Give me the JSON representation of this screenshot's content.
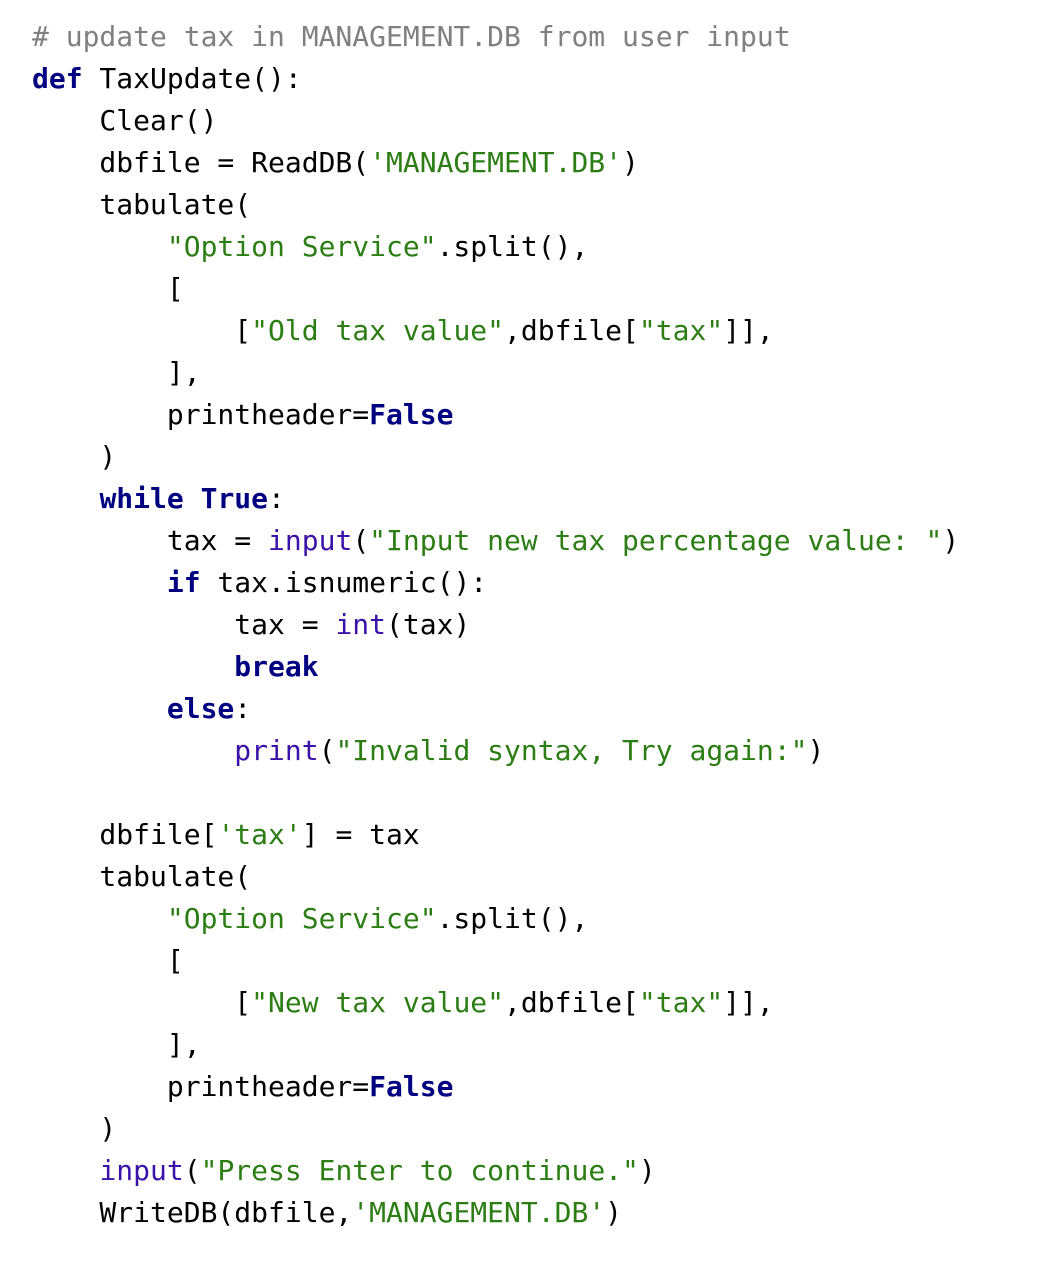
{
  "editor": {
    "colors": {
      "background": "#ffffff",
      "comment": "#808080",
      "keyword": "#000080",
      "string": "#2b7d14",
      "builtin": "#3b12a8",
      "plain": "#000000"
    },
    "lines": [
      [
        {
          "t": "comment",
          "v": "# update tax in MANAGEMENT.DB from user input"
        }
      ],
      [
        {
          "t": "keyword",
          "v": "def"
        },
        {
          "t": "plain",
          "v": " TaxUpdate():"
        }
      ],
      [
        {
          "t": "plain",
          "v": "    Clear()"
        }
      ],
      [
        {
          "t": "plain",
          "v": "    dbfile = ReadDB("
        },
        {
          "t": "string",
          "v": "'MANAGEMENT.DB'"
        },
        {
          "t": "plain",
          "v": ")"
        }
      ],
      [
        {
          "t": "plain",
          "v": "    tabulate("
        }
      ],
      [
        {
          "t": "plain",
          "v": "        "
        },
        {
          "t": "string",
          "v": "\"Option Service\""
        },
        {
          "t": "plain",
          "v": ".split(),"
        }
      ],
      [
        {
          "t": "plain",
          "v": "        ["
        }
      ],
      [
        {
          "t": "plain",
          "v": "            ["
        },
        {
          "t": "string",
          "v": "\"Old tax value\""
        },
        {
          "t": "plain",
          "v": ",dbfile["
        },
        {
          "t": "string",
          "v": "\"tax\""
        },
        {
          "t": "plain",
          "v": "]],"
        }
      ],
      [
        {
          "t": "plain",
          "v": "        ],"
        }
      ],
      [
        {
          "t": "plain",
          "v": "        printheader="
        },
        {
          "t": "keyword",
          "v": "False"
        }
      ],
      [
        {
          "t": "plain",
          "v": "    )"
        }
      ],
      [
        {
          "t": "plain",
          "v": "    "
        },
        {
          "t": "keyword",
          "v": "while"
        },
        {
          "t": "plain",
          "v": " "
        },
        {
          "t": "keyword",
          "v": "True"
        },
        {
          "t": "plain",
          "v": ":"
        }
      ],
      [
        {
          "t": "plain",
          "v": "        tax = "
        },
        {
          "t": "builtin",
          "v": "input"
        },
        {
          "t": "plain",
          "v": "("
        },
        {
          "t": "string",
          "v": "\"Input new tax percentage value: \""
        },
        {
          "t": "plain",
          "v": ")"
        }
      ],
      [
        {
          "t": "plain",
          "v": "        "
        },
        {
          "t": "keyword",
          "v": "if"
        },
        {
          "t": "plain",
          "v": " tax.isnumeric():"
        }
      ],
      [
        {
          "t": "plain",
          "v": "            tax = "
        },
        {
          "t": "builtin",
          "v": "int"
        },
        {
          "t": "plain",
          "v": "(tax)"
        }
      ],
      [
        {
          "t": "plain",
          "v": "            "
        },
        {
          "t": "keyword",
          "v": "break"
        }
      ],
      [
        {
          "t": "plain",
          "v": "        "
        },
        {
          "t": "keyword",
          "v": "else"
        },
        {
          "t": "plain",
          "v": ":"
        }
      ],
      [
        {
          "t": "plain",
          "v": "            "
        },
        {
          "t": "builtin",
          "v": "print"
        },
        {
          "t": "plain",
          "v": "("
        },
        {
          "t": "string",
          "v": "\"Invalid syntax, Try again:\""
        },
        {
          "t": "plain",
          "v": ")"
        }
      ],
      [],
      [
        {
          "t": "plain",
          "v": "    dbfile["
        },
        {
          "t": "string",
          "v": "'tax'"
        },
        {
          "t": "plain",
          "v": "] = tax"
        }
      ],
      [
        {
          "t": "plain",
          "v": "    tabulate("
        }
      ],
      [
        {
          "t": "plain",
          "v": "        "
        },
        {
          "t": "string",
          "v": "\"Option Service\""
        },
        {
          "t": "plain",
          "v": ".split(),"
        }
      ],
      [
        {
          "t": "plain",
          "v": "        ["
        }
      ],
      [
        {
          "t": "plain",
          "v": "            ["
        },
        {
          "t": "string",
          "v": "\"New tax value\""
        },
        {
          "t": "plain",
          "v": ",dbfile["
        },
        {
          "t": "string",
          "v": "\"tax\""
        },
        {
          "t": "plain",
          "v": "]],"
        }
      ],
      [
        {
          "t": "plain",
          "v": "        ],"
        }
      ],
      [
        {
          "t": "plain",
          "v": "        printheader="
        },
        {
          "t": "keyword",
          "v": "False"
        }
      ],
      [
        {
          "t": "plain",
          "v": "    )"
        }
      ],
      [
        {
          "t": "plain",
          "v": "    "
        },
        {
          "t": "builtin",
          "v": "input"
        },
        {
          "t": "plain",
          "v": "("
        },
        {
          "t": "string",
          "v": "\"Press Enter to continue.\""
        },
        {
          "t": "plain",
          "v": ")"
        }
      ],
      [
        {
          "t": "plain",
          "v": "    WriteDB(dbfile,"
        },
        {
          "t": "string",
          "v": "'MANAGEMENT.DB'"
        },
        {
          "t": "plain",
          "v": ")"
        }
      ]
    ]
  }
}
